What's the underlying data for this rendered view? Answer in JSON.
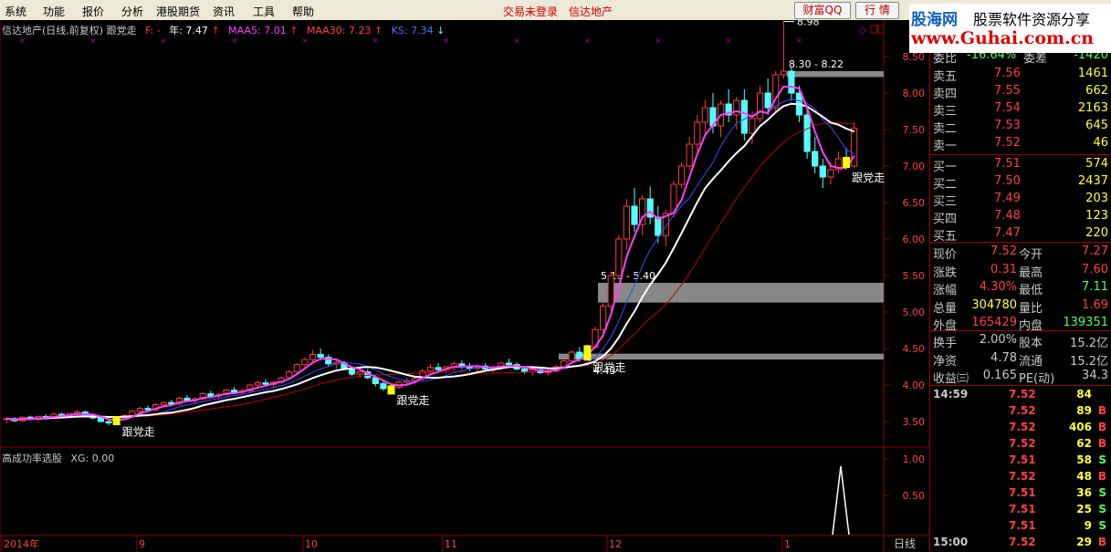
{
  "menu": {
    "items": [
      "系统",
      "功能",
      "报价",
      "分析",
      "港股期货",
      "资讯",
      "工具",
      "帮助"
    ],
    "status": "交易未登录",
    "stock": "信达地产",
    "buttons": [
      "财富QQ",
      "行 情"
    ]
  },
  "watermark": {
    "site_cn": "股海网",
    "slogan": "股票软件资源分享",
    "url": "www.Guhai.com.cn"
  },
  "indicator_line": {
    "name": "信达地产(日线,前复权) 跟党走",
    "f_label": "F: -",
    "year_label": "年: 7.47",
    "maa5": "MAA5: 7.01",
    "maa30": "MAA30: 7.23",
    "ks": "KS: 7.34",
    "arrow_up": "↑",
    "arrow_down": "↓"
  },
  "colors": {
    "up": "#ff3c3c",
    "down": "#54ffff",
    "ma_white": "#ffffff",
    "ma_magenta": "#ff40ff",
    "ma_blue": "#3050ff",
    "ma_red": "#c00000",
    "signal": "#ffff00",
    "label": "#ffffff",
    "grid": "#8b0000"
  },
  "chart_data": {
    "type": "candlestick",
    "y_axis_ticks": [
      "8.50",
      "8.00",
      "7.50",
      "7.00",
      "6.50",
      "6.00",
      "5.50",
      "5.00",
      "4.50",
      "4.00",
      "3.50"
    ],
    "y_range": [
      3.3,
      8.9
    ],
    "x_axis_labels": [
      "2014年",
      "9",
      "10",
      "11",
      "12",
      "1"
    ],
    "period_label": "日线",
    "high_label": "8.98",
    "zones": [
      {
        "label": "8.30 - 8.22",
        "low": 8.22,
        "high": 8.3
      },
      {
        "label": "5.13 - 5.40",
        "low": 5.13,
        "high": 5.4
      },
      {
        "label": "4.43",
        "low": 4.35,
        "high": 4.43
      }
    ],
    "signal_labels": [
      "跟党走",
      "跟党走",
      "跟党走",
      "跟党走"
    ],
    "candles": [
      [
        3.53,
        3.56,
        3.47,
        3.54
      ],
      [
        3.54,
        3.56,
        3.49,
        3.51
      ],
      [
        3.51,
        3.57,
        3.5,
        3.56
      ],
      [
        3.56,
        3.58,
        3.52,
        3.53
      ],
      [
        3.53,
        3.58,
        3.51,
        3.57
      ],
      [
        3.57,
        3.6,
        3.53,
        3.55
      ],
      [
        3.55,
        3.62,
        3.54,
        3.6
      ],
      [
        3.6,
        3.62,
        3.56,
        3.58
      ],
      [
        3.58,
        3.62,
        3.56,
        3.61
      ],
      [
        3.61,
        3.66,
        3.58,
        3.63
      ],
      [
        3.63,
        3.65,
        3.58,
        3.59
      ],
      [
        3.59,
        3.61,
        3.53,
        3.55
      ],
      [
        3.55,
        3.57,
        3.49,
        3.5
      ],
      [
        3.5,
        3.53,
        3.45,
        3.48
      ],
      [
        3.48,
        3.56,
        3.47,
        3.55
      ],
      [
        3.55,
        3.6,
        3.53,
        3.58
      ],
      [
        3.58,
        3.66,
        3.56,
        3.64
      ],
      [
        3.64,
        3.7,
        3.61,
        3.68
      ],
      [
        3.68,
        3.72,
        3.63,
        3.66
      ],
      [
        3.66,
        3.75,
        3.64,
        3.73
      ],
      [
        3.73,
        3.78,
        3.7,
        3.76
      ],
      [
        3.76,
        3.8,
        3.71,
        3.74
      ],
      [
        3.74,
        3.84,
        3.72,
        3.82
      ],
      [
        3.82,
        3.86,
        3.77,
        3.79
      ],
      [
        3.79,
        3.83,
        3.74,
        3.81
      ],
      [
        3.81,
        3.9,
        3.79,
        3.88
      ],
      [
        3.88,
        3.92,
        3.83,
        3.85
      ],
      [
        3.85,
        3.89,
        3.8,
        3.87
      ],
      [
        3.87,
        3.95,
        3.85,
        3.93
      ],
      [
        3.93,
        3.97,
        3.88,
        3.9
      ],
      [
        3.9,
        3.95,
        3.86,
        3.92
      ],
      [
        3.92,
        4.02,
        3.9,
        4.0
      ],
      [
        4.0,
        4.06,
        3.96,
        4.03
      ],
      [
        4.03,
        4.08,
        3.98,
        4.01
      ],
      [
        4.01,
        4.05,
        3.96,
        4.04
      ],
      [
        4.04,
        4.12,
        4.02,
        4.1
      ],
      [
        4.1,
        4.2,
        4.08,
        4.18
      ],
      [
        4.18,
        4.3,
        4.15,
        4.28
      ],
      [
        4.28,
        4.38,
        4.24,
        4.35
      ],
      [
        4.35,
        4.48,
        4.32,
        4.42
      ],
      [
        4.42,
        4.5,
        4.34,
        4.38
      ],
      [
        4.38,
        4.42,
        4.26,
        4.29
      ],
      [
        4.29,
        4.34,
        4.22,
        4.31
      ],
      [
        4.31,
        4.33,
        4.2,
        4.22
      ],
      [
        4.22,
        4.26,
        4.12,
        4.15
      ],
      [
        4.15,
        4.2,
        4.1,
        4.18
      ],
      [
        4.18,
        4.22,
        4.08,
        4.1
      ],
      [
        4.1,
        4.14,
        3.98,
        4.02
      ],
      [
        4.02,
        4.06,
        3.92,
        3.95
      ],
      [
        3.95,
        4.0,
        3.9,
        3.97
      ],
      [
        3.97,
        4.06,
        3.95,
        4.04
      ],
      [
        4.04,
        4.1,
        4.0,
        4.06
      ],
      [
        4.06,
        4.12,
        4.02,
        4.09
      ],
      [
        4.09,
        4.22,
        4.06,
        4.19
      ],
      [
        4.19,
        4.28,
        4.15,
        4.24
      ],
      [
        4.24,
        4.3,
        4.18,
        4.21
      ],
      [
        4.21,
        4.26,
        4.16,
        4.25
      ],
      [
        4.25,
        4.32,
        4.2,
        4.29
      ],
      [
        4.29,
        4.34,
        4.22,
        4.26
      ],
      [
        4.26,
        4.3,
        4.19,
        4.23
      ],
      [
        4.23,
        4.28,
        4.18,
        4.26
      ],
      [
        4.26,
        4.3,
        4.2,
        4.22
      ],
      [
        4.22,
        4.27,
        4.17,
        4.24
      ],
      [
        4.24,
        4.32,
        4.2,
        4.3
      ],
      [
        4.3,
        4.36,
        4.25,
        4.28
      ],
      [
        4.28,
        4.31,
        4.2,
        4.22
      ],
      [
        4.22,
        4.26,
        4.15,
        4.18
      ],
      [
        4.18,
        4.23,
        4.12,
        4.21
      ],
      [
        4.21,
        4.25,
        4.15,
        4.17
      ],
      [
        4.17,
        4.22,
        4.13,
        4.19
      ],
      [
        4.19,
        4.28,
        4.17,
        4.25
      ],
      [
        4.25,
        4.35,
        4.23,
        4.33
      ],
      [
        4.33,
        4.48,
        4.3,
        4.45
      ],
      [
        4.45,
        4.52,
        4.32,
        4.36
      ],
      [
        4.36,
        4.55,
        4.35,
        4.52
      ],
      [
        4.52,
        4.8,
        4.5,
        4.76
      ],
      [
        4.76,
        5.12,
        4.72,
        5.08
      ],
      [
        5.08,
        5.55,
        5.02,
        5.5
      ],
      [
        5.5,
        6.05,
        5.45,
        6.0
      ],
      [
        6.0,
        6.55,
        5.85,
        6.45
      ],
      [
        6.45,
        6.7,
        6.1,
        6.2
      ],
      [
        6.2,
        6.6,
        6.05,
        6.55
      ],
      [
        6.55,
        6.72,
        6.2,
        6.3
      ],
      [
        6.3,
        6.45,
        5.95,
        6.05
      ],
      [
        6.05,
        6.4,
        5.9,
        6.35
      ],
      [
        6.35,
        6.8,
        6.3,
        6.75
      ],
      [
        6.75,
        7.05,
        6.7,
        7.0
      ],
      [
        7.0,
        7.4,
        6.95,
        7.3
      ],
      [
        7.3,
        7.7,
        7.2,
        7.6
      ],
      [
        7.6,
        7.9,
        7.4,
        7.8
      ],
      [
        7.8,
        8.0,
        7.45,
        7.55
      ],
      [
        7.55,
        7.9,
        7.4,
        7.85
      ],
      [
        7.85,
        8.05,
        7.6,
        7.7
      ],
      [
        7.7,
        7.95,
        7.5,
        7.9
      ],
      [
        7.9,
        8.05,
        7.35,
        7.45
      ],
      [
        7.45,
        7.75,
        7.3,
        7.65
      ],
      [
        7.65,
        8.1,
        7.6,
        8.0
      ],
      [
        8.0,
        8.2,
        7.7,
        7.8
      ],
      [
        7.8,
        8.3,
        7.75,
        8.25
      ],
      [
        8.25,
        8.98,
        8.2,
        8.3
      ],
      [
        8.3,
        8.35,
        7.9,
        8.0
      ],
      [
        8.0,
        8.1,
        7.6,
        7.7
      ],
      [
        7.7,
        7.8,
        7.1,
        7.2
      ],
      [
        7.2,
        7.4,
        6.9,
        7.0
      ],
      [
        7.0,
        7.1,
        6.7,
        6.85
      ],
      [
        6.85,
        7.05,
        6.75,
        6.95
      ],
      [
        6.95,
        7.2,
        6.9,
        7.1
      ],
      [
        7.1,
        7.25,
        6.95,
        7.0
      ],
      [
        7.0,
        7.6,
        6.98,
        7.52
      ]
    ]
  },
  "sub_chart": {
    "title": "高成功率选股",
    "xg_label": "XG: 0.00",
    "y_ticks": [
      "1.00",
      "0.50"
    ]
  },
  "quote": {
    "weibi_label": "委比",
    "weibi_value": "-16.64%",
    "weicha_label": "委差",
    "weicha_value": "-1420",
    "sell": [
      {
        "label": "卖五",
        "price": "7.56",
        "vol": "1461"
      },
      {
        "label": "卖四",
        "price": "7.55",
        "vol": "662"
      },
      {
        "label": "卖三",
        "price": "7.54",
        "vol": "2163"
      },
      {
        "label": "卖二",
        "price": "7.53",
        "vol": "645"
      },
      {
        "label": "卖一",
        "price": "7.52",
        "vol": "46"
      }
    ],
    "buy": [
      {
        "label": "买一",
        "price": "7.51",
        "vol": "574"
      },
      {
        "label": "买二",
        "price": "7.50",
        "vol": "2437"
      },
      {
        "label": "买三",
        "price": "7.49",
        "vol": "203"
      },
      {
        "label": "买四",
        "price": "7.48",
        "vol": "123"
      },
      {
        "label": "买五",
        "price": "7.47",
        "vol": "220"
      }
    ],
    "stats": [
      {
        "l1": "现价",
        "v1": "7.52",
        "l2": "今开",
        "v2": "7.27"
      },
      {
        "l1": "涨跌",
        "v1": "0.31",
        "l2": "最高",
        "v2": "7.60"
      },
      {
        "l1": "涨幅",
        "v1": "4.30%",
        "l2": "最低",
        "v2": "7.11"
      },
      {
        "l1": "总量",
        "v1": "304780",
        "l2": "量比",
        "v2": "1.69"
      },
      {
        "l1": "外盘",
        "v1": "165429",
        "l2": "内盘",
        "v2": "139351"
      },
      {
        "l1": "换手",
        "v1": "2.00%",
        "l2": "股本",
        "v2": "15.2亿"
      },
      {
        "l1": "净资",
        "v1": "4.78",
        "l2": "流通",
        "v2": "15.2亿"
      },
      {
        "l1": "收益㈢",
        "v1": "0.165",
        "l2": "PE(动)",
        "v2": "34.3"
      }
    ],
    "ticks": [
      {
        "time": "14:59",
        "price": "7.52",
        "vol": "84",
        "dir": ""
      },
      {
        "time": "",
        "price": "7.52",
        "vol": "89",
        "dir": "B"
      },
      {
        "time": "",
        "price": "7.52",
        "vol": "406",
        "dir": "B"
      },
      {
        "time": "",
        "price": "7.52",
        "vol": "62",
        "dir": "B"
      },
      {
        "time": "",
        "price": "7.51",
        "vol": "58",
        "dir": "S"
      },
      {
        "time": "",
        "price": "7.52",
        "vol": "48",
        "dir": "B"
      },
      {
        "time": "",
        "price": "7.51",
        "vol": "36",
        "dir": "S"
      },
      {
        "time": "",
        "price": "7.51",
        "vol": "25",
        "dir": "S"
      },
      {
        "time": "",
        "price": "7.51",
        "vol": "9",
        "dir": "S"
      },
      {
        "time": "15:00",
        "price": "7.52",
        "vol": "29",
        "dir": "B"
      }
    ]
  }
}
